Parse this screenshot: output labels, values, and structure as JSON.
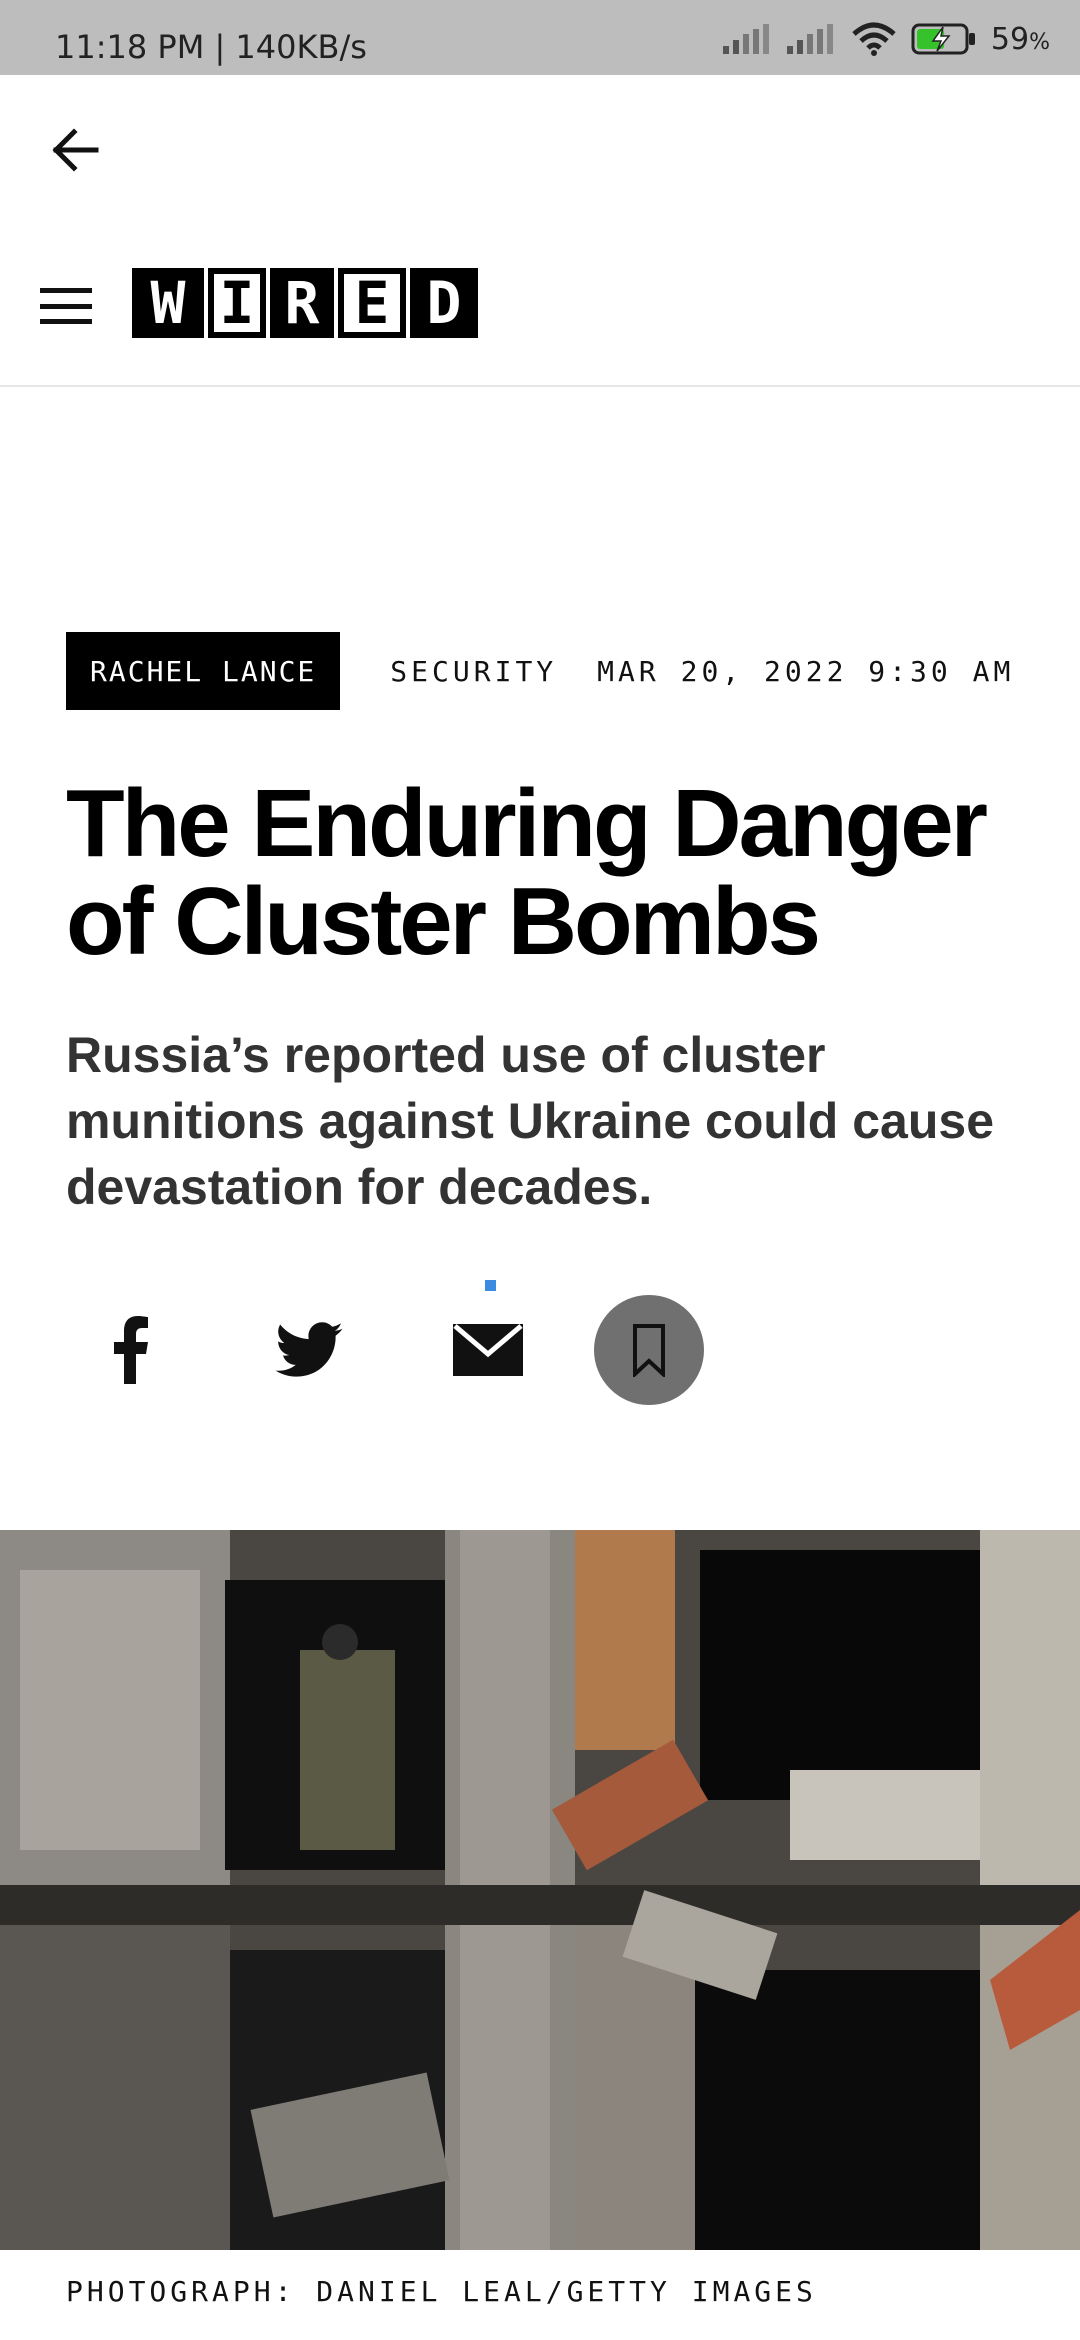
{
  "status_bar": {
    "time_speed": "11:18 PM | 140KB/s",
    "battery_percent": "59",
    "battery_unit": "%",
    "battery_level": 0.59
  },
  "icons": {
    "back": "arrow-left-icon",
    "menu": "hamburger-menu-icon",
    "facebook": "facebook-icon",
    "twitter": "twitter-icon",
    "email": "mail-icon",
    "bookmark": "bookmark-icon"
  },
  "header": {
    "logo_letters": [
      "W",
      "I",
      "R",
      "E",
      "D"
    ]
  },
  "article": {
    "author": "RACHEL LANCE",
    "section": "SECURITY",
    "date": "MAR 20, 2022 9:30 AM",
    "title": "The Enduring Danger of Cluster Bombs",
    "dek": "Russia’s reported use of cluster munitions against Ukraine could cause devastation for decades.",
    "photo_credit": "PHOTOGRAPH: DANIEL LEAL/GETTY IMAGES"
  },
  "colors": {
    "status_bar_bg": "#bdbdbd",
    "save_button_bg": "#707070",
    "accent_dot": "#3b8be0",
    "battery_green": "#35c22b"
  }
}
